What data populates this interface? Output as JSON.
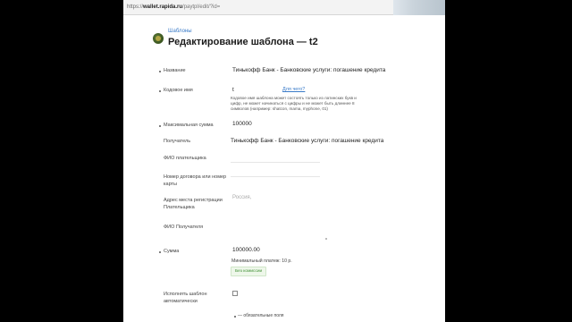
{
  "browser": {
    "url_prefix": "https://",
    "url_host": "wallet.rapida.ru",
    "url_rest": "/paytpl/edit/?id="
  },
  "page": {
    "breadcrumb": "Шаблоны",
    "title": "Редактирование шаблона — t2"
  },
  "form": {
    "name_label": "Название",
    "name_value": "Тинькофф Банк - Банковские услуги: погашение кредита",
    "code_label": "Кодовое имя",
    "code_value": "t",
    "code_link": "Для чего?",
    "code_hint": "Кодовое имя шаблона может состоять только из латинских букв и цифр, не может начинаться с цифры и не может быть длиннее 8 символов (например: shatcon, mama, myphone, 01)",
    "max_sum_label": "Максимальная сумма",
    "max_sum_value": "100000",
    "recipient_label": "Получатель",
    "recipient_value": "Тинькофф Банк - Банковские услуги: погашение кредита",
    "payer_name_label": "ФИО плательщика",
    "contract_label": "Номер договора или номер карты",
    "address_label": "Адрес места регистрации Плательщика",
    "address_placeholder": "Россия,",
    "recipient_name_label": "ФИО Получателя",
    "amount_label": "Сумма",
    "amount_value": "100000.00",
    "min_payment": "Минимальный платеж: 10 р.",
    "no_commission": "Без комиссии",
    "auto_label": "Исполнять шаблон автоматически",
    "required_legend": "— обязательные поля"
  }
}
